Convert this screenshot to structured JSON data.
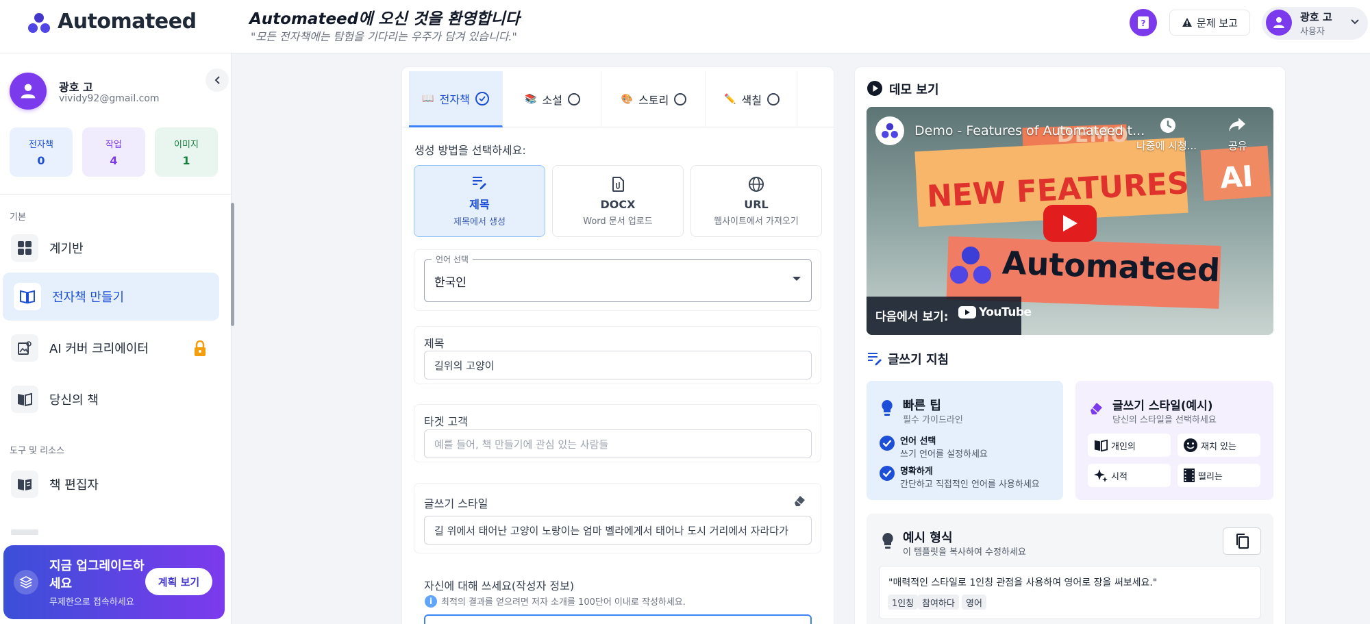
{
  "app": {
    "name": "Automateed",
    "welcome": "Automateed에 오신 것을 환영합니다",
    "quote": "\"모든 전자책에는 탐험을 기다리는 우주가 담겨 있습니다.\"",
    "report_label": "문제 보고",
    "user_name": "광호 고",
    "user_role": "사용자",
    "brand_color": "#7c3aed",
    "accent_color": "#3b82f6"
  },
  "sidebar": {
    "name": "광호 고",
    "email": "vividy92@gmail.com",
    "stats": [
      {
        "label": "전자책",
        "value": "0"
      },
      {
        "label": "작업",
        "value": "4"
      },
      {
        "label": "이미지",
        "value": "1"
      }
    ],
    "section_basic": "기본",
    "section_tools": "도구 및 리소스",
    "items": [
      {
        "label": "계기반",
        "icon": "grid-icon"
      },
      {
        "label": "전자책 만들기",
        "icon": "book-open-icon"
      },
      {
        "label": "AI 커버 크리에이터",
        "icon": "image-edit-icon"
      },
      {
        "label": "당신의 책",
        "icon": "book-icon"
      },
      {
        "label": "책 편집자",
        "icon": "book-edit-icon"
      }
    ],
    "upgrade": {
      "title": "지금 업그레이드하세요",
      "subtitle": "무제한으로 접속하세요",
      "button": "계획 보기"
    }
  },
  "main": {
    "tabs": [
      {
        "label": "전자책",
        "icon": "book-icon",
        "selected": true
      },
      {
        "label": "소설",
        "icon": "books-icon",
        "selected": false
      },
      {
        "label": "스토리",
        "icon": "palette-icon",
        "selected": false
      },
      {
        "label": "색칠",
        "icon": "pencil-icon",
        "selected": false
      }
    ],
    "gen_label": "생성 방법을 선택하세요:",
    "methods": [
      {
        "title": "제목",
        "subtitle": "제목에서 생성",
        "icon": "edit-lines-icon"
      },
      {
        "title": "DOCX",
        "subtitle": "Word 문서 업로드",
        "icon": "file-icon"
      },
      {
        "title": "URL",
        "subtitle": "웹사이트에서 가져오기",
        "icon": "globe-icon"
      }
    ],
    "language": {
      "legend": "언어 선택",
      "value": "한국인"
    },
    "title_field": {
      "label": "제목",
      "value": "길위의 고양이"
    },
    "audience_field": {
      "label": "타겟 고객",
      "placeholder": "예를 들어, 책 만들기에 관심 있는 사람들"
    },
    "style_field": {
      "label": "글쓰기 스타일",
      "value": "길 위에서 태어난 고양이 노랑이는 엄마 벨라에게서 태어나 도시 거리에서 자라다가"
    },
    "about_field": {
      "label": "자신에 대해 쓰세요(작성자 정보)",
      "hint": "최적의 결과를 얻으려면 저자 소개를 100단어 이내로 작성하세요."
    }
  },
  "right": {
    "demo_title": "데모 보기",
    "video": {
      "title": "Demo - Features of Automateed t...",
      "watch_later": "나중에 시청...",
      "share": "공유",
      "thumb_demo": "DEMO",
      "thumb_new_features": "NEW FEATURES",
      "thumb_ai": "AI",
      "thumb_brand": "Automateed",
      "watch_on": "다음에서 보기:",
      "youtube": "YouTube"
    },
    "guide_title": "글쓰기 지침",
    "tips": {
      "title": "빠른 팁",
      "subtitle": "필수 가이드라인",
      "items": [
        {
          "title": "언어 선택",
          "desc": "쓰기 언어를 설정하세요"
        },
        {
          "title": "명확하게",
          "desc": "간단하고 직접적인 언어를 사용하세요"
        }
      ]
    },
    "styles": {
      "title": "글쓰기 스타일(예시)",
      "subtitle": "당신의 스타일을 선택하세요",
      "chips": [
        {
          "label": "개인의",
          "icon": "open-book-icon"
        },
        {
          "label": "재치 있는",
          "icon": "smile-icon"
        },
        {
          "label": "시적",
          "icon": "sparkles-icon"
        },
        {
          "label": "떨리는",
          "icon": "film-icon"
        }
      ]
    },
    "example": {
      "title": "예시 형식",
      "subtitle": "이 템플릿을 복사하여 수정하세요",
      "text": "\"매력적인 스타일로 1인칭 관점을 사용하여 영어로 장을 써보세요.\"",
      "tags": [
        "1인칭",
        "참여하다",
        "영어"
      ]
    }
  }
}
